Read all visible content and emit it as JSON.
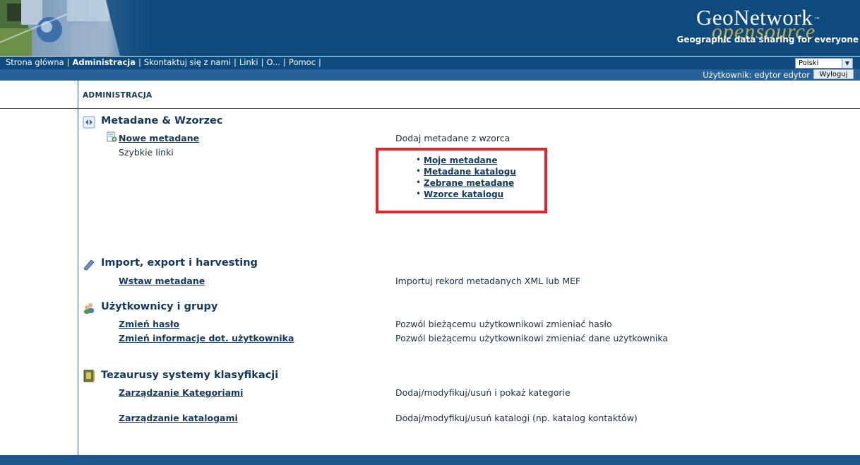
{
  "header": {
    "logo_main": "GeoNetwork",
    "logo_tm": "™",
    "logo_sub": "opensource",
    "tagline": "Geographic data sharing for everyone"
  },
  "nav": {
    "items": [
      "Strona główna",
      "Administracja",
      "Skontaktuj się z nami",
      "Linki",
      "O...",
      "Pomoc"
    ],
    "separator": "|",
    "active": "Administracja",
    "language": "Polski"
  },
  "userbar": {
    "label": "Użytkownik: edytor edytor",
    "logout": "Wyloguj"
  },
  "page": {
    "heading": "ADMINISTRACJA"
  },
  "sections": {
    "metadata": {
      "title": "Metadane & Wzorzec",
      "new_link": "Nowe metadane",
      "new_desc": "Dodaj metadane z wzorca",
      "quick_links_label": "Szybkie linki",
      "quick_links": [
        "Moje metadane",
        "Metadane katalogu",
        "Zebrane metadane",
        "Wzorce katalogu"
      ]
    },
    "import": {
      "title": "Import, export i harvesting",
      "link": "Wstaw metadane",
      "desc": "Importuj rekord metadanych XML lub MEF"
    },
    "users": {
      "title": "Użytkownicy i grupy",
      "link1": "Zmień hasło",
      "desc1": "Pozwól bieżącemu użytkownikowi zmieniać hasło",
      "link2": "Zmień informacje dot. użytkownika",
      "desc2": "Pozwól bieżącemu użytkownikowi zmieniać dane użytkownika"
    },
    "thesaurus": {
      "title": "Tezaurusy systemy klasyfikacji",
      "link1": "Zarządzanie Kategoriami",
      "desc1": "Dodaj/modyfikuj/usuń i pokaż kategorie",
      "link2": "Zarządzanie katalogami",
      "desc2": "Dodaj/modyfikuj/usuń katalogi (np. katalog kontaktów)"
    }
  },
  "colors": {
    "banner": "#0e4a7e",
    "userbar": "#266197",
    "text": "#14385f",
    "highlight": "#e0262b"
  }
}
